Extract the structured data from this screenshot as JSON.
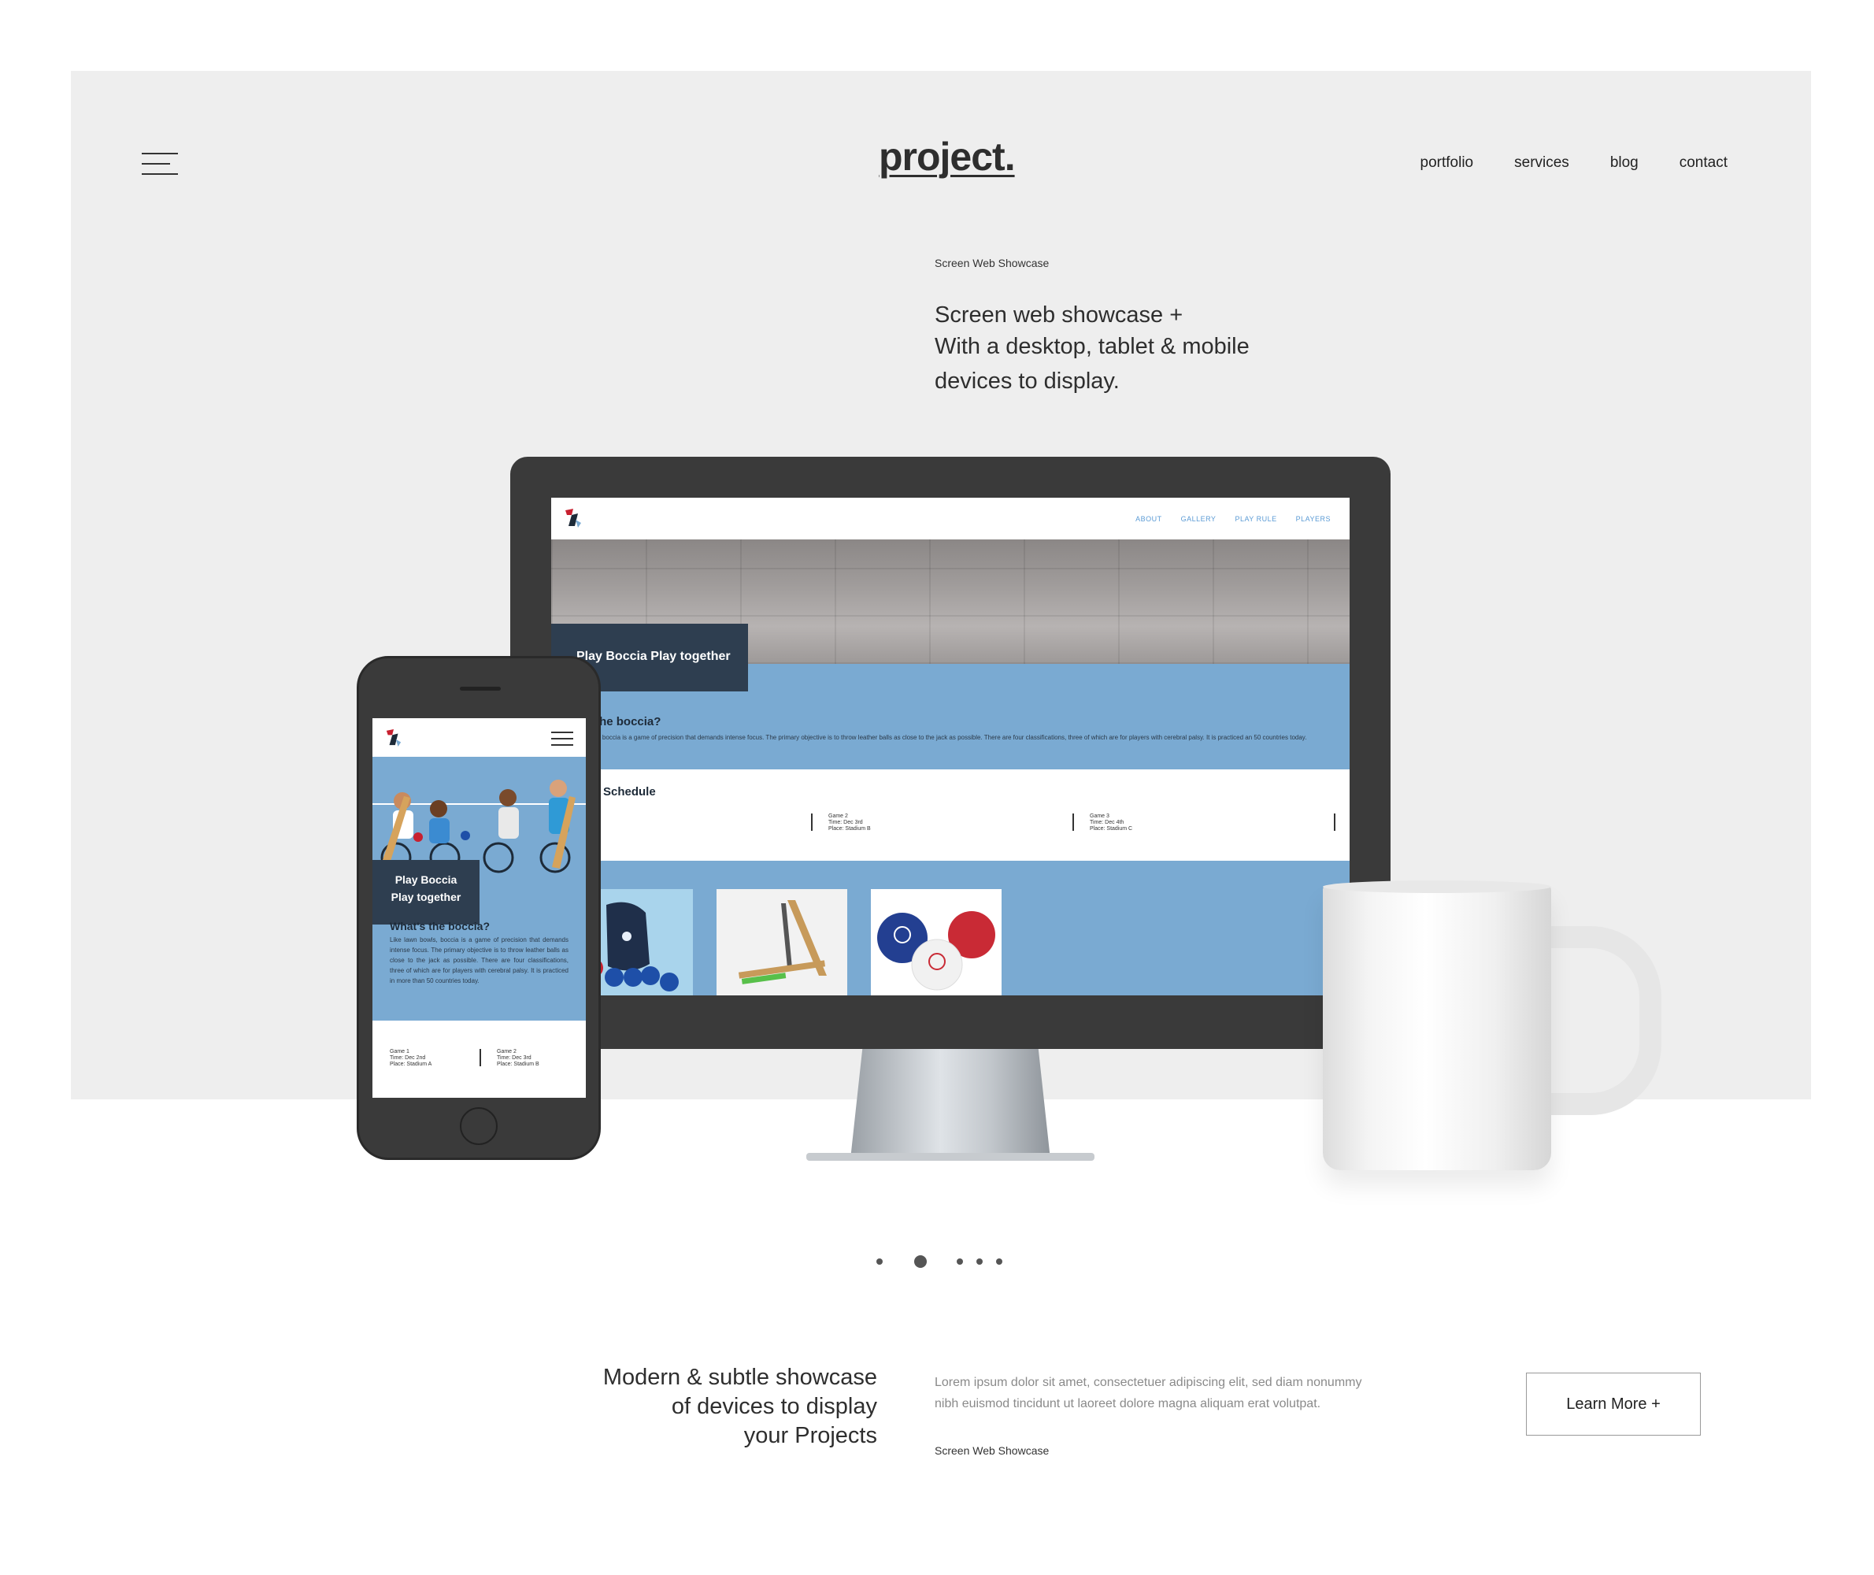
{
  "header": {
    "logo": "project.",
    "nav": [
      "portfolio",
      "services",
      "blog",
      "contact"
    ]
  },
  "hero": {
    "eyebrow": "Screen Web Showcase",
    "title_line1": "Screen web showcase +",
    "title_line2": "With a desktop, tablet & mobile",
    "title_line3": "devices to display."
  },
  "desktop_site": {
    "nav": [
      "ABOUT",
      "GALLERY",
      "PLAY RULE",
      "PLAYERS"
    ],
    "badge": "Play Boccia Play together",
    "heading": "'s the boccia?",
    "paragraph": "bowls, boccia is a game of precision that demands intense focus. The primary objective is to throw leather balls as close to the jack as possible. There are four classifications, three of which are for players with cerebral palsy. It is practiced an 50 countries today.",
    "schedule_heading": "Schedule",
    "games": [
      {
        "line1": "nd",
        "line2": "m A",
        "line3": ""
      },
      {
        "line1": "Game 2",
        "line2": "Time: Dec 3rd",
        "line3": "Place: Stadium B"
      },
      {
        "line1": "Game 3",
        "line2": "Time: Dec 4th",
        "line3": "Place: Stadium C"
      }
    ]
  },
  "mobile_site": {
    "badge_line1": "Play Boccia",
    "badge_line2": "Play together",
    "heading": "What's the boccia?",
    "paragraph": "Like lawn bowls, boccia is a game of precision that demands intense focus. The primary objective is to throw leather balls as close to the jack as possible. There are four classifications, three of which are for players with cerebral palsy. It is practiced in more than 50 countries today.",
    "games": [
      {
        "line1": "Game 1",
        "line2": "Time: Dec 2nd",
        "line3": "Place: Stadium A"
      },
      {
        "line1": "Game 2",
        "line2": "Time: Dec 3rd",
        "line3": "Place: Stadium B"
      }
    ]
  },
  "pager": {
    "count": 5,
    "active": 1
  },
  "bottom": {
    "title_line1": "Modern & subtle showcase",
    "title_line2": "of devices to display",
    "title_line3": "your Projects",
    "lorem": "Lorem ipsum dolor sit amet, consectetuer adipiscing elit, sed diam nonummy nibh euismod tincidunt ut laoreet dolore magna aliquam erat volutpat.",
    "eyebrow": "Screen Web Showcase",
    "button": "Learn More +"
  },
  "colors": {
    "hero_bg": "#eeeeee",
    "site_blue": "#7aaad2",
    "site_navy": "#2e3e50",
    "device_dark": "#3a3a3a"
  }
}
